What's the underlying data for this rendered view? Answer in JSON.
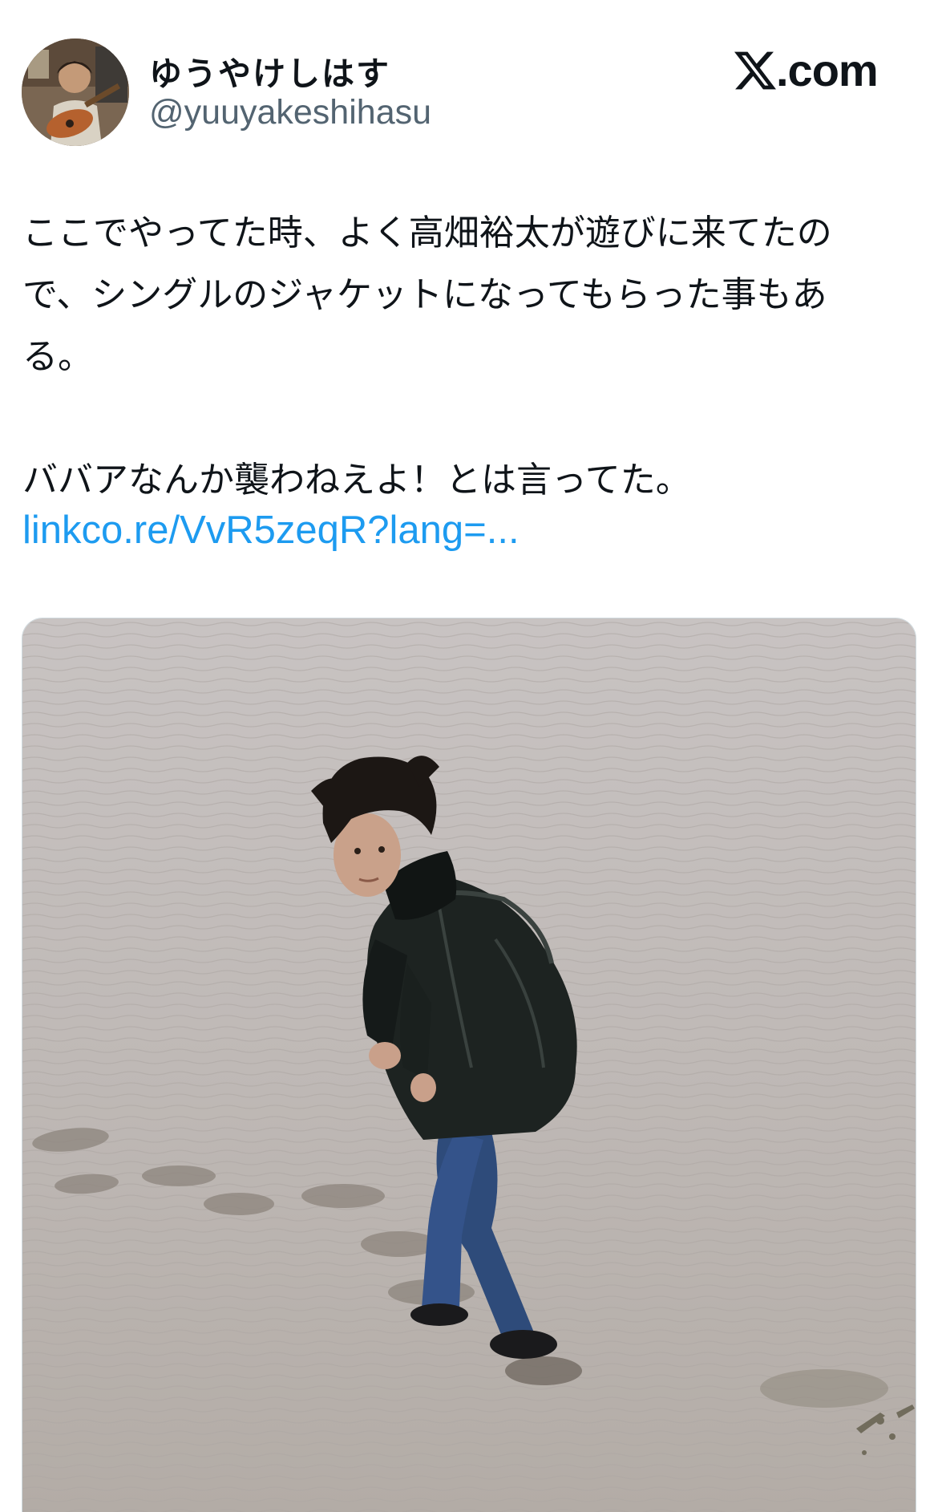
{
  "user": {
    "display_name": "ゆうやけしはす",
    "handle": "@yuuyakeshihasu"
  },
  "brand": {
    "logo_text": ".com",
    "logo_icon": "x-logo-icon"
  },
  "tweet": {
    "lines": [
      "ここでやってた時、よく高畑裕太が遊びに来てたの",
      "で、シングルのジャケットになってもらった事もあ",
      "る。",
      "ババアなんか襲わねえよ！とは言ってた。"
    ],
    "link_text": "linkco.re/VvR5zeqR?lang=..."
  },
  "colors": {
    "text": "#0f1419",
    "secondary": "#536471",
    "link": "#1d9bf0"
  }
}
